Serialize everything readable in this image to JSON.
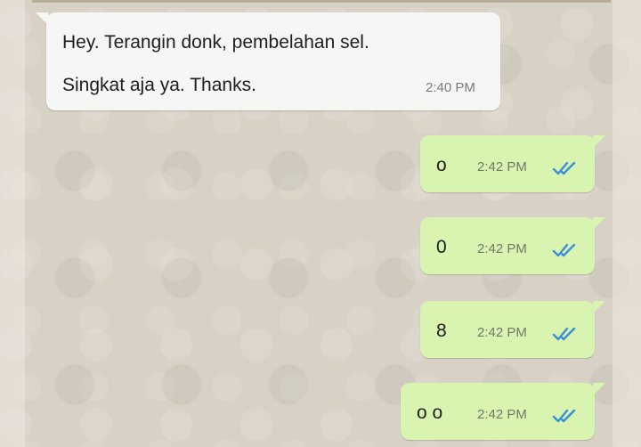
{
  "incoming": {
    "line1": "Hey.  Terangin donk, pembelahan sel.",
    "line2": "Singkat aja ya.  Thanks.",
    "time": "2:40 PM"
  },
  "outgoing": [
    {
      "text": "o",
      "time": "2:42 PM",
      "status": "read-double-check-icon"
    },
    {
      "text": "0",
      "time": "2:42 PM",
      "status": "read-double-check-icon"
    },
    {
      "text": "8",
      "time": "2:42 PM",
      "status": "read-double-check-icon"
    },
    {
      "text": "o o",
      "time": "2:42 PM",
      "status": "read-double-check-icon"
    }
  ],
  "colors": {
    "incoming_bubble": "#f6f6f4",
    "outgoing_bubble": "#d8f4b0",
    "read_ticks": "#3b8fd6"
  }
}
